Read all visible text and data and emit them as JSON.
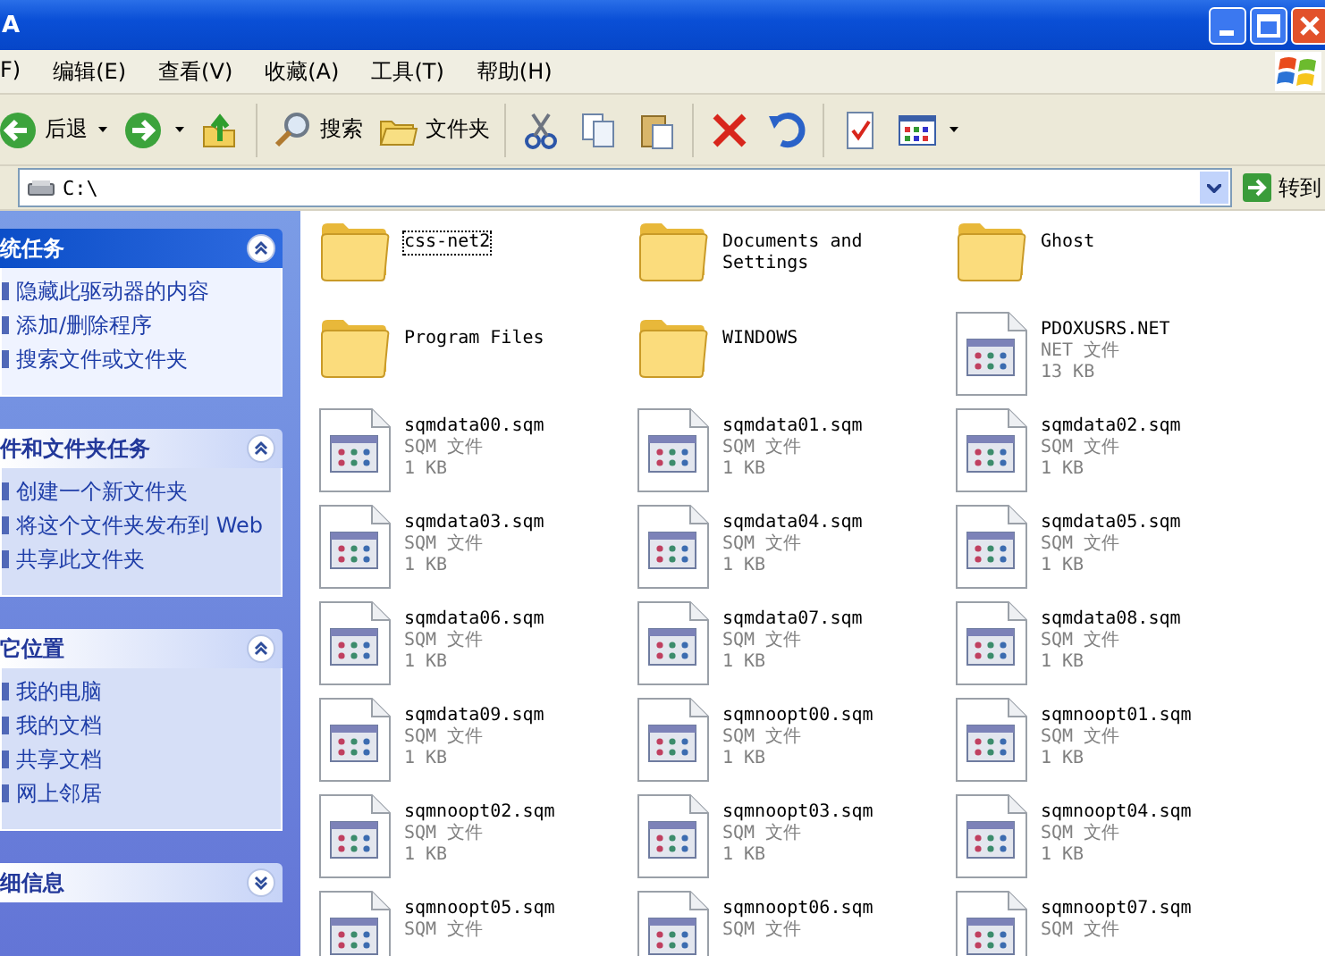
{
  "title_bar": {
    "title": "A"
  },
  "menu_bar": {
    "items": [
      "F)",
      "编辑(E)",
      "查看(V)",
      "收藏(A)",
      "工具(T)",
      "帮助(H)"
    ]
  },
  "toolbar": {
    "groups": [
      [
        {
          "kind": "back",
          "label": "后退",
          "dropdown": true
        },
        {
          "kind": "forward",
          "dropdown": true
        },
        {
          "kind": "up"
        }
      ],
      [
        {
          "kind": "search",
          "label": "搜索"
        },
        {
          "kind": "folders",
          "label": "文件夹"
        }
      ],
      [
        {
          "kind": "cut"
        },
        {
          "kind": "copy"
        },
        {
          "kind": "paste"
        }
      ],
      [
        {
          "kind": "delete"
        },
        {
          "kind": "undo"
        }
      ],
      [
        {
          "kind": "properties"
        },
        {
          "kind": "views",
          "dropdown": true
        }
      ]
    ]
  },
  "address_bar": {
    "value": "C:\\",
    "go_label": "转到"
  },
  "task_panes": [
    {
      "title": "统任务",
      "expanded": true,
      "items": [
        "隐藏此驱动器的内容",
        "添加/删除程序",
        "搜索文件或文件夹"
      ]
    },
    {
      "title": "件和文件夹任务",
      "expanded": true,
      "items": [
        "创建一个新文件夹",
        "将这个文件夹发布到 Web",
        "共享此文件夹"
      ]
    },
    {
      "title": "它位置",
      "expanded": true,
      "items": [
        "我的电脑",
        "我的文档",
        "共享文档",
        "网上邻居"
      ]
    },
    {
      "title": "细信息",
      "expanded": false
    }
  ],
  "files": [
    {
      "kind": "folder",
      "name": "css-net2",
      "focused": true
    },
    {
      "kind": "folder",
      "name": "Documents and Settings",
      "focused": false
    },
    {
      "kind": "folder",
      "name": "Ghost",
      "focused": false
    },
    {
      "kind": "folder",
      "name": "Program Files",
      "focused": false
    },
    {
      "kind": "folder",
      "name": "WINDOWS",
      "focused": false
    },
    {
      "kind": "file",
      "name": "PDOXUSRS.NET",
      "type": "NET 文件",
      "size": "13 KB",
      "focused": false
    },
    {
      "kind": "file",
      "name": "sqmdata00.sqm",
      "type": "SQM 文件",
      "size": "1 KB",
      "focused": false
    },
    {
      "kind": "file",
      "name": "sqmdata01.sqm",
      "type": "SQM 文件",
      "size": "1 KB",
      "focused": false
    },
    {
      "kind": "file",
      "name": "sqmdata02.sqm",
      "type": "SQM 文件",
      "size": "1 KB",
      "focused": false
    },
    {
      "kind": "file",
      "name": "sqmdata03.sqm",
      "type": "SQM 文件",
      "size": "1 KB",
      "focused": false
    },
    {
      "kind": "file",
      "name": "sqmdata04.sqm",
      "type": "SQM 文件",
      "size": "1 KB",
      "focused": false
    },
    {
      "kind": "file",
      "name": "sqmdata05.sqm",
      "type": "SQM 文件",
      "size": "1 KB",
      "focused": false
    },
    {
      "kind": "file",
      "name": "sqmdata06.sqm",
      "type": "SQM 文件",
      "size": "1 KB",
      "focused": false
    },
    {
      "kind": "file",
      "name": "sqmdata07.sqm",
      "type": "SQM 文件",
      "size": "1 KB",
      "focused": false
    },
    {
      "kind": "file",
      "name": "sqmdata08.sqm",
      "type": "SQM 文件",
      "size": "1 KB",
      "focused": false
    },
    {
      "kind": "file",
      "name": "sqmdata09.sqm",
      "type": "SQM 文件",
      "size": "1 KB",
      "focused": false
    },
    {
      "kind": "file",
      "name": "sqmnoopt00.sqm",
      "type": "SQM 文件",
      "size": "1 KB",
      "focused": false
    },
    {
      "kind": "file",
      "name": "sqmnoopt01.sqm",
      "type": "SQM 文件",
      "size": "1 KB",
      "focused": false
    },
    {
      "kind": "file",
      "name": "sqmnoopt02.sqm",
      "type": "SQM 文件",
      "size": "1 KB",
      "focused": false
    },
    {
      "kind": "file",
      "name": "sqmnoopt03.sqm",
      "type": "SQM 文件",
      "size": "1 KB",
      "focused": false
    },
    {
      "kind": "file",
      "name": "sqmnoopt04.sqm",
      "type": "SQM 文件",
      "size": "1 KB",
      "focused": false
    },
    {
      "kind": "file",
      "name": "sqmnoopt05.sqm",
      "type": "SQM 文件",
      "focused": false
    },
    {
      "kind": "file",
      "name": "sqmnoopt06.sqm",
      "type": "SQM 文件",
      "focused": false
    },
    {
      "kind": "file",
      "name": "sqmnoopt07.sqm",
      "type": "SQM 文件",
      "focused": false
    }
  ]
}
